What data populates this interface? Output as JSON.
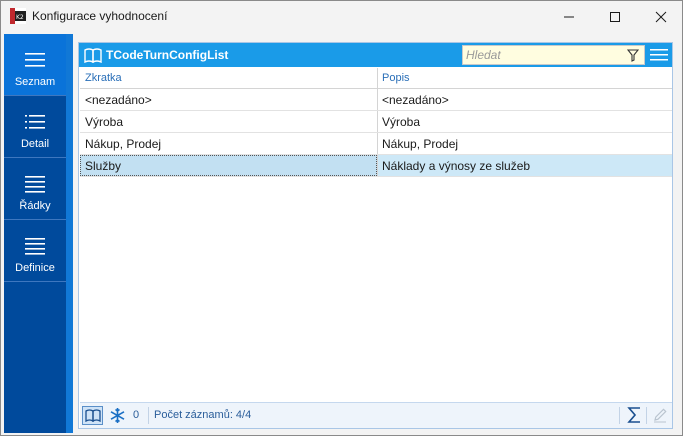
{
  "window": {
    "title": "Konfigurace vyhodnocení",
    "icon": "app-logo-icon"
  },
  "sidebar": {
    "items": [
      {
        "label": "Seznam",
        "icon": "list-icon",
        "active": true
      },
      {
        "label": "Detail",
        "icon": "detail-list-icon",
        "active": false
      },
      {
        "label": "Řádky",
        "icon": "rows-icon",
        "active": false
      },
      {
        "label": "Definice",
        "icon": "definition-icon",
        "active": false
      }
    ]
  },
  "panel": {
    "title": "TCodeTurnConfigList",
    "search_placeholder": "Hledat"
  },
  "grid": {
    "columns": [
      "Zkratka",
      "Popis"
    ],
    "rows": [
      {
        "zkratka": "<nezadáno>",
        "popis": "<nezadáno>"
      },
      {
        "zkratka": "Výroba",
        "popis": "Výroba"
      },
      {
        "zkratka": "Nákup, Prodej",
        "popis": "Nákup, Prodej"
      },
      {
        "zkratka": "Služby",
        "popis": "Náklady a výnosy ze služeb"
      }
    ],
    "selected_index": 3
  },
  "status": {
    "filter_count": "0",
    "records": "Počet záznamů: 4/4"
  },
  "colors": {
    "sidebar": "#004a9c",
    "sidebar_active": "#0a73d9",
    "header": "#1a9be8",
    "selected_row": "#cde8f7"
  }
}
